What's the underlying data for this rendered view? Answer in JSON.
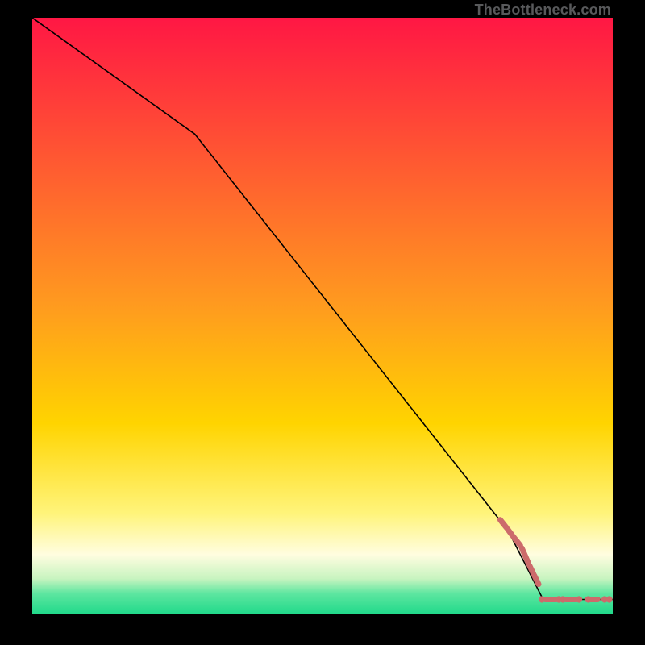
{
  "attribution": "TheBottleneck.com",
  "colors": {
    "top": "#ff1744",
    "mid": "#ffd400",
    "pale": "#fffde0",
    "green": "#1fd98a",
    "line": "#000000",
    "segment": "#cc6b6b",
    "dot": "#cc6b6b"
  },
  "chart_data": {
    "type": "line",
    "title": "",
    "xlabel": "",
    "ylabel": "",
    "xlim": [
      0,
      100
    ],
    "ylim": [
      0,
      100
    ],
    "background_gradient": {
      "stops": [
        {
          "pos": 0.0,
          "color": "#ff1744"
        },
        {
          "pos": 0.48,
          "color": "#ff9a1f"
        },
        {
          "pos": 0.68,
          "color": "#ffd400"
        },
        {
          "pos": 0.83,
          "color": "#fff47a"
        },
        {
          "pos": 0.9,
          "color": "#fffde0"
        },
        {
          "pos": 0.94,
          "color": "#c8f4c0"
        },
        {
          "pos": 0.965,
          "color": "#5ee6a0"
        },
        {
          "pos": 1.0,
          "color": "#1fd98a"
        }
      ]
    },
    "series": [
      {
        "name": "curve",
        "style": "solid",
        "color": "#000000",
        "points": [
          {
            "x": 0,
            "y": 100
          },
          {
            "x": 28,
            "y": 80.5
          },
          {
            "x": 82,
            "y": 14
          },
          {
            "x": 88,
            "y": 2.5
          },
          {
            "x": 100,
            "y": 2.5
          }
        ]
      },
      {
        "name": "highlight-segments",
        "style": "thick-segments",
        "color": "#cc6b6b",
        "points": [
          {
            "x": 80.5,
            "y": 16.0
          },
          {
            "x": 81.8,
            "y": 14.4
          },
          {
            "x": 82.8,
            "y": 13.1
          },
          {
            "x": 84.2,
            "y": 11.4
          },
          {
            "x": 85.6,
            "y": 8.3
          },
          {
            "x": 86.4,
            "y": 6.7
          },
          {
            "x": 87.3,
            "y": 4.9
          }
        ]
      },
      {
        "name": "bottom-dots",
        "style": "dots",
        "color": "#cc6b6b",
        "points": [
          {
            "x": 87.8,
            "y": 2.5
          },
          {
            "x": 89.3,
            "y": 2.5
          },
          {
            "x": 90.7,
            "y": 2.5
          },
          {
            "x": 91.4,
            "y": 2.5
          },
          {
            "x": 92.8,
            "y": 2.5
          },
          {
            "x": 94.2,
            "y": 2.5
          },
          {
            "x": 95.8,
            "y": 2.5
          },
          {
            "x": 96.5,
            "y": 2.5
          },
          {
            "x": 98.6,
            "y": 2.5
          },
          {
            "x": 99.4,
            "y": 2.5
          }
        ]
      }
    ]
  }
}
